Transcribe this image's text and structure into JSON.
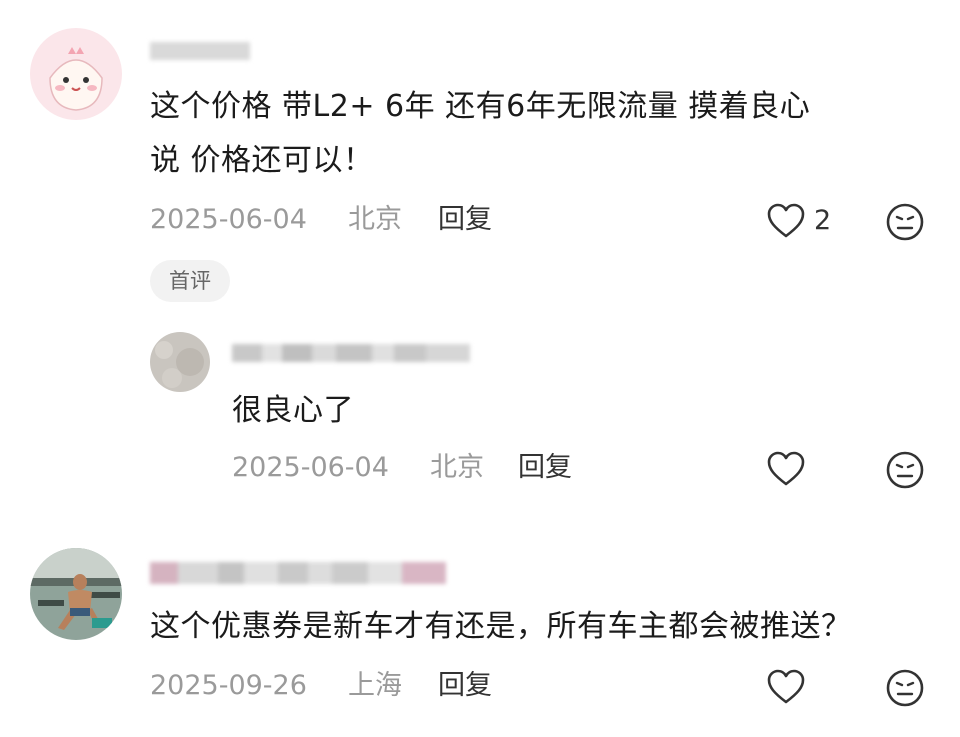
{
  "comments": [
    {
      "text_line1": "这个价格 带L2+ 6年 还有6年无限流量 摸着良心",
      "text_line2": "说 价格还可以！",
      "date": "2025-06-04",
      "location": "北京",
      "reply_label": "回复",
      "like_count": "2",
      "badge": "首评",
      "avatar": "cartoon-pink-avatar",
      "replies": [
        {
          "text": "很良心了",
          "date": "2025-06-04",
          "location": "北京",
          "reply_label": "回复",
          "avatar": "gray-texture-avatar"
        }
      ]
    },
    {
      "text": "这个优惠券是新车才有还是，所有车主都会被推送？",
      "date": "2025-09-26",
      "location": "上海",
      "reply_label": "回复",
      "avatar": "gym-photo-avatar"
    }
  ],
  "icons": {
    "like": "heart-outline-icon",
    "emoji": "meh-face-icon"
  },
  "colors": {
    "meta_text": "#9a9a9a",
    "body_text": "#1b1b1b",
    "badge_bg": "#f2f2f2"
  }
}
